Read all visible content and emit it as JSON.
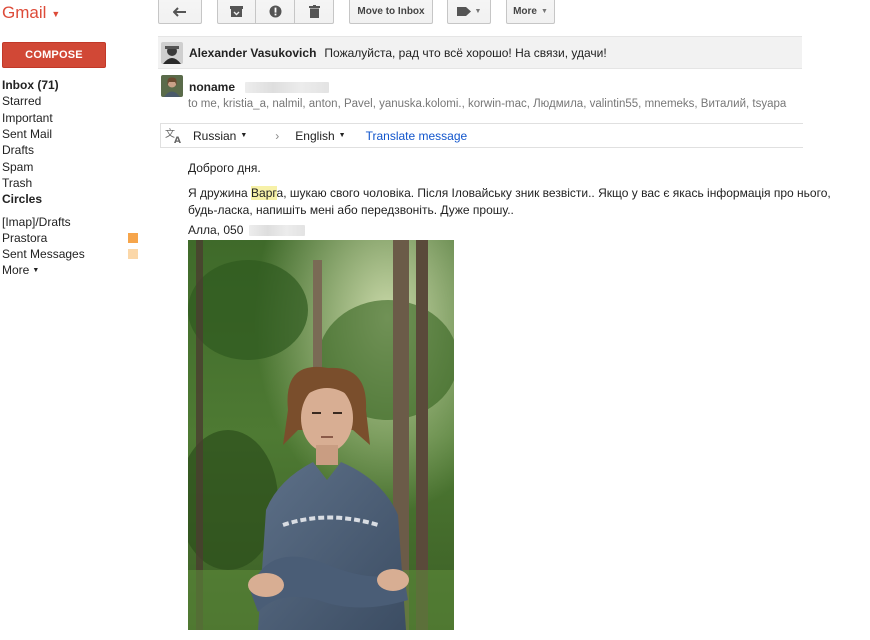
{
  "app": {
    "logo": "Gmail"
  },
  "toolbar": {
    "move_to_inbox": "Move to Inbox",
    "more": "More"
  },
  "sidebar": {
    "compose": "COMPOSE",
    "items": [
      {
        "label": "Inbox (71)",
        "bold": true
      },
      {
        "label": "Starred"
      },
      {
        "label": "Important"
      },
      {
        "label": "Sent Mail"
      },
      {
        "label": "Drafts"
      },
      {
        "label": "Spam"
      },
      {
        "label": "Trash"
      },
      {
        "label": "Circles",
        "bold": true
      },
      {
        "label": "[Imap]/Drafts"
      },
      {
        "label": "Prastora",
        "color": "#f6a54b"
      },
      {
        "label": "Sent Messages",
        "color": "#fbd7a8"
      },
      {
        "label": "More"
      }
    ]
  },
  "thread": {
    "message1": {
      "sender": "Alexander Vasukovich",
      "snippet": "Пожалуйста, рад что всё хорошо! На связи, удачи!"
    },
    "message2": {
      "sender": "noname",
      "recipients": "to me, kristia_a, nalmil, anton, Pavel, yanuska.kolomi., korwin-mac, Людмила, valintin55, mnemeks, Виталий, tsyapa"
    },
    "translate": {
      "from": "Russian",
      "to": "English",
      "link": "Translate message"
    },
    "body": {
      "greeting": "Доброго дня.",
      "line1_pre": "Я дружина ",
      "line1_hl": "Варг",
      "line1_post": "а, шукаю свого чоловіка. Після Іловайську зник везвісти.. Якщо у вас є якась інформація про нього,",
      "line2": "будь-ласка, напишіть мені або передзвоніть. Дуже прошу..",
      "signature": "Алла, 050"
    }
  },
  "colors": {
    "accent": "#d14836",
    "logo": "#dd4b39",
    "link": "#1155cc"
  }
}
